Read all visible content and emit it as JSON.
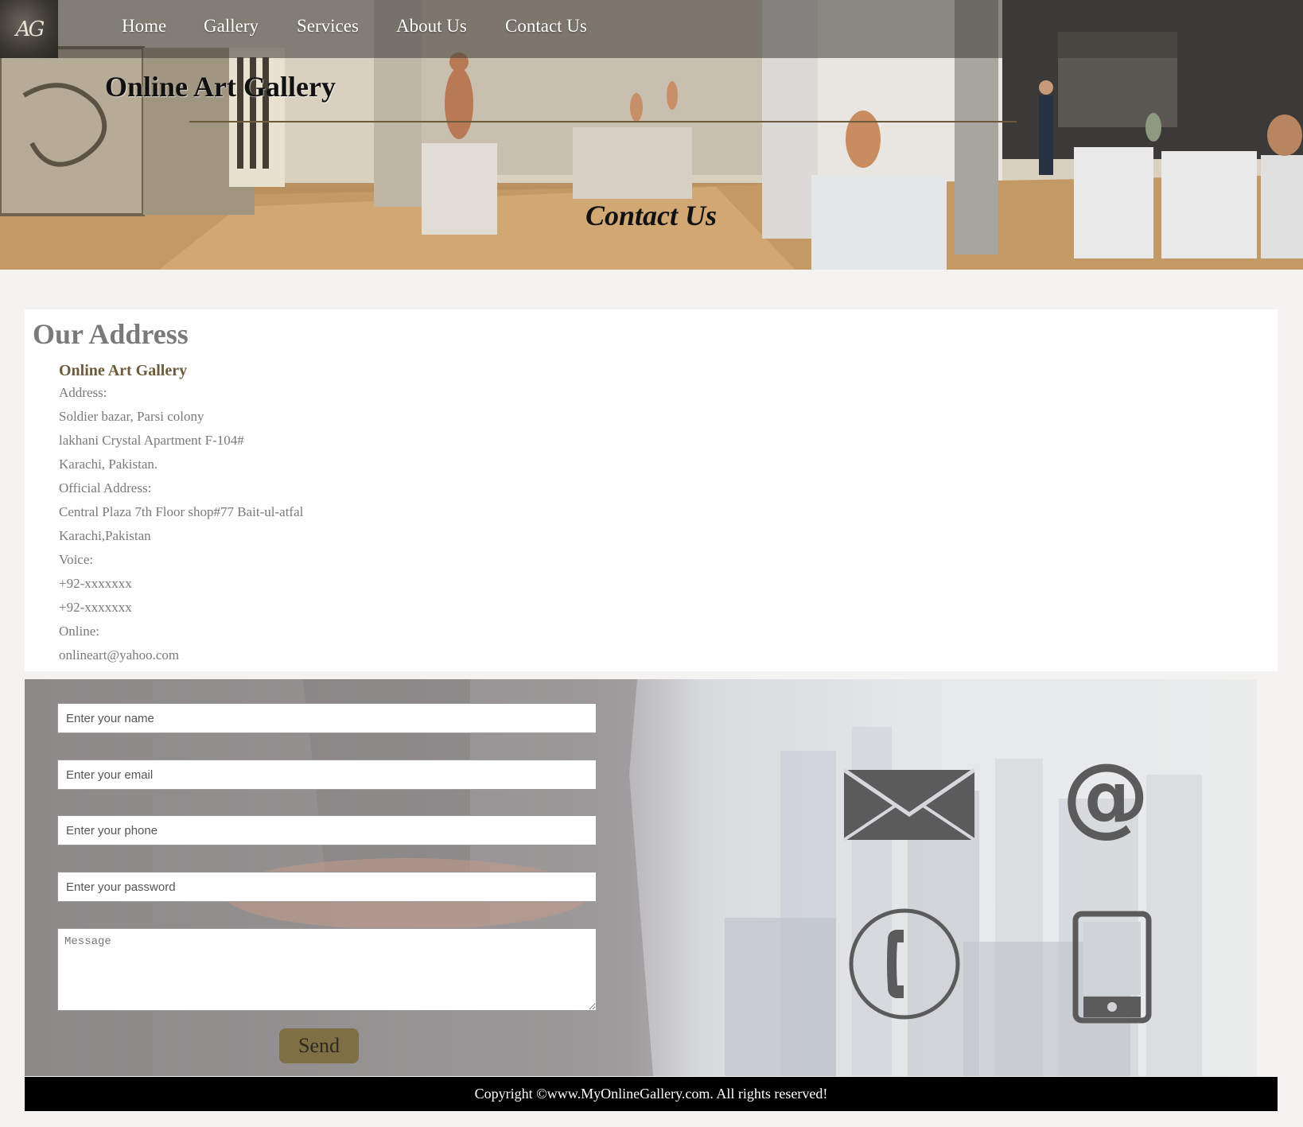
{
  "header": {
    "logo_text": "AG",
    "nav": [
      {
        "label": "Home"
      },
      {
        "label": "Gallery"
      },
      {
        "label": "Services"
      },
      {
        "label": "About Us"
      },
      {
        "label": "Contact Us"
      }
    ],
    "site_title": "Online Art Gallery",
    "page_heading": "Contact Us"
  },
  "address": {
    "title": "Our Address",
    "org_name": "Online Art Gallery",
    "lines": [
      "Address:",
      "Soldier bazar, Parsi colony",
      "lakhani Crystal Apartment F-104#",
      "Karachi, Pakistan.",
      "Official Address:",
      "Central Plaza 7th Floor shop#77 Bait-ul-atfal",
      "Karachi,Pakistan",
      "Voice:",
      "+92-xxxxxxx",
      "+92-xxxxxxx",
      "Online:",
      "onlineart@yahoo.com"
    ]
  },
  "form": {
    "name_placeholder": "Enter your name",
    "email_placeholder": "Enter your email",
    "phone_placeholder": "Enter your phone",
    "password_placeholder": "Enter your password",
    "message_placeholder": "Message",
    "send_label": "Send",
    "icons": [
      "envelope-icon",
      "at-sign-icon",
      "telephone-icon",
      "mobile-phone-icon"
    ]
  },
  "footer": {
    "copyright": "Copyright ©www.MyOnlineGallery.com. All rights reserved!"
  },
  "colors": {
    "accent_gold": "#7f6f45",
    "heading_gray": "#7a7a7a",
    "org_brown": "#6d5c3c",
    "footer_bg": "#000000"
  }
}
